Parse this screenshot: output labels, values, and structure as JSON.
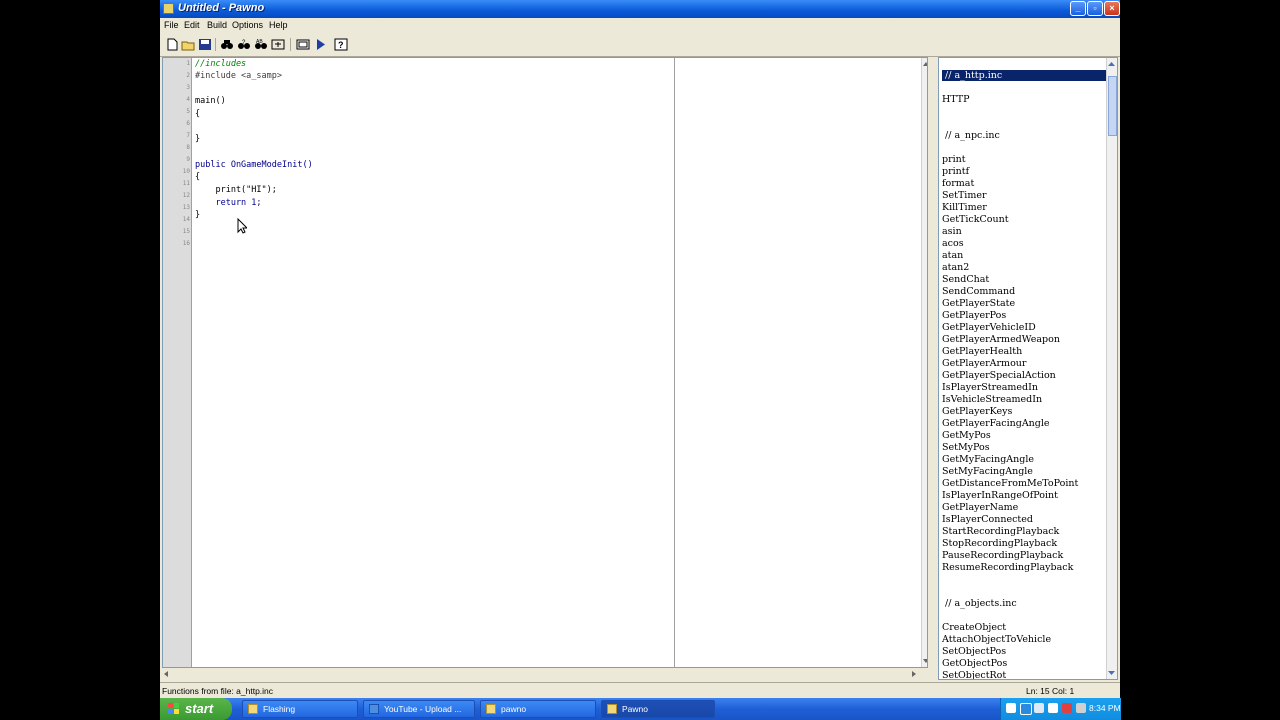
{
  "window": {
    "title": "Untitled - Pawno"
  },
  "menu": [
    "File",
    "Edit",
    "Build",
    "Options",
    "Help"
  ],
  "toolbar": [
    "new-icon",
    "open-icon",
    "save-icon",
    "find-icon",
    "find-next-icon",
    "replace-icon",
    "goto-icon",
    "compile-icon",
    "run-icon",
    "help-icon"
  ],
  "editor": {
    "line_numbers": [
      "1",
      "2",
      "3",
      "4",
      "5",
      "6",
      "7",
      "8",
      "9",
      "10",
      "11",
      "12",
      "13",
      "14",
      "15",
      "16"
    ],
    "lines": [
      {
        "text": "//includes",
        "style": "comment"
      },
      {
        "text": "#include <a_samp>",
        "style": "dark"
      },
      {
        "text": "",
        "style": "plain"
      },
      {
        "text": "main()",
        "style": "plain"
      },
      {
        "text": "{",
        "style": "plain"
      },
      {
        "text": "",
        "style": "plain"
      },
      {
        "text": "}",
        "style": "plain"
      },
      {
        "text": "",
        "style": "plain"
      },
      {
        "text": "public OnGameModeInit()",
        "style": "kw"
      },
      {
        "text": "{",
        "style": "plain"
      },
      {
        "text": "    print(\"HI\");",
        "style": "plain"
      },
      {
        "text": "    return 1;",
        "style": "kw"
      },
      {
        "text": "}",
        "style": "plain"
      },
      {
        "text": "",
        "style": "plain"
      },
      {
        "text": "",
        "style": "plain"
      },
      {
        "text": "",
        "style": "plain"
      }
    ]
  },
  "functions_panel": {
    "sel_header": " // a_http.inc",
    "http_items": [
      "HTTP"
    ],
    "npc_header": " // a_npc.inc",
    "npc_items": [
      "print",
      "printf",
      "format",
      "SetTimer",
      "KillTimer",
      "GetTickCount",
      "asin",
      "acos",
      "atan",
      "atan2",
      "SendChat",
      "SendCommand",
      "GetPlayerState",
      "GetPlayerPos",
      "GetPlayerVehicleID",
      "GetPlayerArmedWeapon",
      "GetPlayerHealth",
      "GetPlayerArmour",
      "GetPlayerSpecialAction",
      "IsPlayerStreamedIn",
      "IsVehicleStreamedIn",
      "GetPlayerKeys",
      "GetPlayerFacingAngle",
      "GetMyPos",
      "SetMyPos",
      "GetMyFacingAngle",
      "SetMyFacingAngle",
      "GetDistanceFromMeToPoint",
      "IsPlayerInRangeOfPoint",
      "GetPlayerName",
      "IsPlayerConnected",
      "StartRecordingPlayback",
      "StopRecordingPlayback",
      "PauseRecordingPlayback",
      "ResumeRecordingPlayback"
    ],
    "objects_header": " // a_objects.inc",
    "objects_items": [
      "CreateObject",
      "AttachObjectToVehicle",
      "SetObjectPos",
      "GetObjectPos",
      "SetObjectRot"
    ]
  },
  "status": {
    "left": "Functions from file: a_http.inc",
    "right": "Ln: 15  Col: 1"
  },
  "taskbar": {
    "start": "start",
    "tasks": [
      "Flashing",
      "YouTube - Upload ...",
      "pawno",
      "Pawno"
    ],
    "clock": "8:34 PM"
  }
}
